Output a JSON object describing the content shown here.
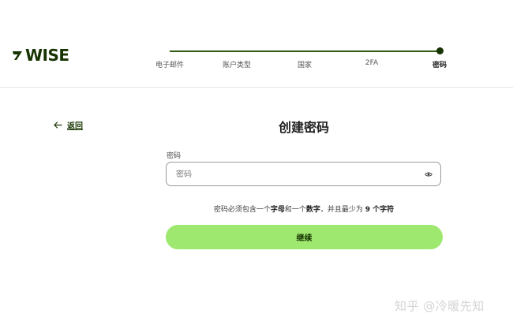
{
  "brand": {
    "logo_text": "WISE",
    "accent": "#9fe870",
    "dark": "#163300"
  },
  "steps": [
    {
      "label": "电子邮件",
      "active": false
    },
    {
      "label": "账户类型",
      "active": false
    },
    {
      "label": "国家",
      "active": false
    },
    {
      "label": "2FA",
      "active": false
    },
    {
      "label": "密码",
      "active": true
    }
  ],
  "back": {
    "label": "返回"
  },
  "title": "创建密码",
  "password": {
    "label": "密码",
    "placeholder": "密码",
    "value": ""
  },
  "hint": {
    "part1": "密码必须包含一个",
    "letter": "字母",
    "part2": "和一个",
    "digit": "数字",
    "part3": "，并且最少为",
    "count": "9 个字符"
  },
  "submit_label": "继续",
  "watermark": "知乎 @冷暖先知"
}
